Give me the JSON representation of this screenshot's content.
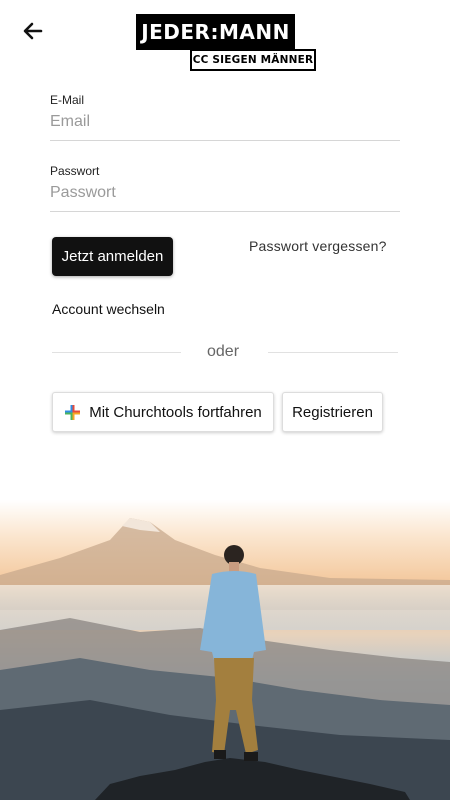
{
  "header": {
    "back_icon": "arrow-left-icon",
    "logo_main": "JEDER:MANN",
    "logo_sub": "CC SIEGEN MÄNNER"
  },
  "form": {
    "email_label": "E-Mail",
    "email_placeholder": "Email",
    "email_value": "",
    "password_label": "Passwort",
    "password_placeholder": "Passwort",
    "password_value": "",
    "login_button": "Jetzt anmelden",
    "forgot_password": "Passwort vergessen?",
    "switch_account": "Account wechseln"
  },
  "divider_text": "oder",
  "alt_actions": {
    "churchtools_button": "Mit Churchtools fortfahren",
    "churchtools_icon": "churchtools-cross-icon",
    "register_button": "Registrieren"
  },
  "colors": {
    "primary_button": "#111111",
    "churchtools_blue": "#2f8de4",
    "churchtools_red": "#e54b3c",
    "churchtools_green": "#49b35f",
    "churchtools_orange": "#f5a623"
  }
}
